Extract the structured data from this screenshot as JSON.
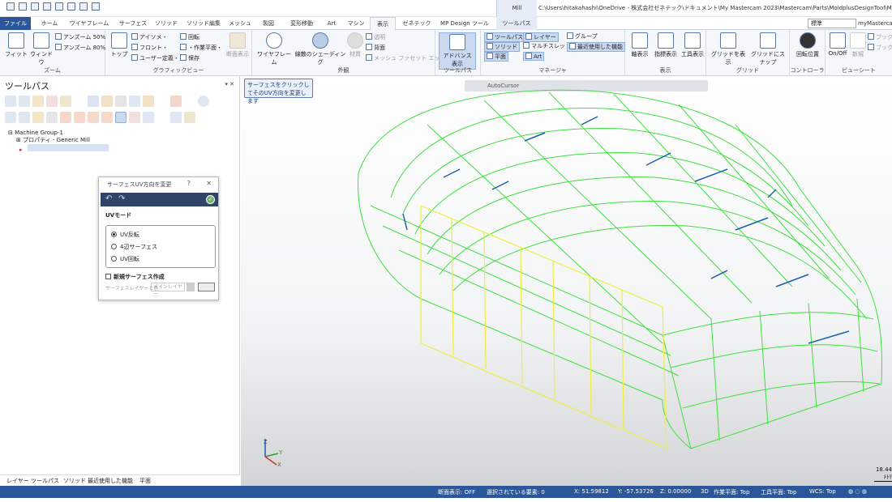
{
  "window": {
    "title": "C:\\Users\\hitakahashi\\OneDrive - 株式会社ゼネテック\\ドキュメント\\My Mastercam 2023\\Mastercam\\Parts\\MoldplusDesignTool\\Moldplu...",
    "context_tab": "Mill",
    "view_select": "標準",
    "account": "myMastercam"
  },
  "tabs": [
    "ファイル",
    "ホーム",
    "ワイヤフレーム",
    "サーフェス",
    "ソリッド",
    "ソリッド編集",
    "メッシュ",
    "製図",
    "変形移動",
    "Art",
    "マシン",
    "表示",
    "ゼネテック",
    "MP Design ツール",
    "ツールパス"
  ],
  "ribbon": {
    "zoom": {
      "label": "ズーム",
      "fit": "フィット",
      "window": "ウィンドウ",
      "zoom_in": "アンズーム 50%",
      "zoom_out": "アンズーム 80%"
    },
    "graphic_view": {
      "label": "グラフィックビュー",
      "top": "トップ",
      "iso": "アイソメ・",
      "front": "フロント・",
      "user": "ユーザー定義・",
      "rotate": "回転",
      "work_plane": "・作業平面・",
      "save": "保存",
      "section": "断面表示"
    },
    "appearance": {
      "label": "外観",
      "wireframe": "ワイヤフレーム",
      "shaded": "線散のシェーディング",
      "material": "材質",
      "transparent": "透明",
      "back": "背面",
      "mesh_facet": "メッシュ ファセット エッジ"
    },
    "toolpath": {
      "label": "ツールパス",
      "advanced": "アドバンス表示"
    },
    "manager": {
      "label": "マネージャ",
      "toolpath": "ツールパス",
      "solid": "ソリッド",
      "plane": "平面",
      "layer": "レイヤー",
      "multithread": "マルチスレッド",
      "art": "Art",
      "group": "グループ",
      "recent": "最近使用した機能"
    },
    "display": {
      "label": "表示",
      "axes": "軸表示",
      "indicator": "指標表示",
      "tool": "工具表示"
    },
    "grid": {
      "label": "グリッド",
      "show_grid": "グリッドを表示",
      "snap": "グリッドにスナップ"
    },
    "controller": {
      "label": "コントローラ",
      "rotation_pos": "回転位置"
    },
    "viewsheet": {
      "label": "ビューシート",
      "onoff": "On/Off",
      "new": "新規",
      "book1": "ブック",
      "book2": "ブック"
    }
  },
  "panel": {
    "title": "ツールパス",
    "controls": "▾ ✕",
    "tree": {
      "group": "Machine Group-1",
      "props": "プロパティ - Generic Mill"
    },
    "bottom_tabs": [
      "レイヤー",
      "ツールパス",
      "ソリッド",
      "最近使用した機能",
      "平面"
    ]
  },
  "dialog": {
    "title": "サーフェスUV方向を変更",
    "help": "?",
    "close": "✕",
    "undo": "↶",
    "redo": "↷",
    "ok": "✓",
    "uv_mode": "UVモード",
    "options": [
      "UV反転",
      "4辺サーフェス",
      "UV回転"
    ],
    "selected": 0,
    "new_surface": "新規サーフェス作成",
    "layer_color_label": "サーフェスレイヤーと色",
    "layer_input": "メインレイヤー"
  },
  "viewport": {
    "hint": "サーフェスをクリックしてそのUV方向を変更します",
    "autocursor": "AutoCursor",
    "scale": "18.44",
    "scale_unit": "ﾒﾄﾘ",
    "axis_z": "Z",
    "axis_y": "Y",
    "axis_x": "X",
    "colors": {
      "wire": "#3ee03e",
      "yellow": "#eeee44",
      "normal": "#1d5fa8"
    }
  },
  "status": {
    "section": "断面表示: OFF",
    "selected": "選択されている要素: 0",
    "x": "X: 51.59812",
    "y": "Y: -57.53726",
    "z": "Z: 0.00000",
    "mode": "3D",
    "work_plane": "作業平面: Top",
    "tool_plane": "工具平面: Top",
    "wcs": "WCS: Top"
  }
}
